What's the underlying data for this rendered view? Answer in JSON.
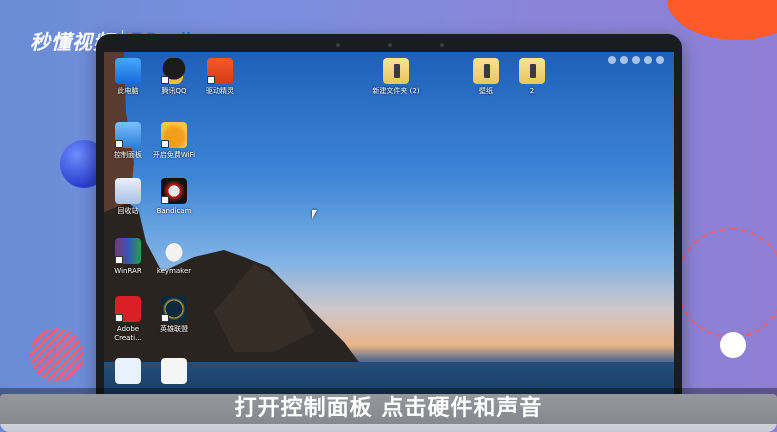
{
  "logo": {
    "main": "秒懂视频",
    "brand": "PConline"
  },
  "desktop": {
    "icons": [
      {
        "id": "this-pc",
        "label": "此电脑"
      },
      {
        "id": "tencent-qq",
        "label": "腾讯QQ"
      },
      {
        "id": "zhuyinjingling",
        "label": "驱动精灵"
      },
      {
        "id": "new-folder",
        "label": "新建文件夹 (2)"
      },
      {
        "id": "folder-1",
        "label": "壁纸"
      },
      {
        "id": "folder-2",
        "label": "2"
      },
      {
        "id": "control-panel",
        "label": "控制面板"
      },
      {
        "id": "wifi",
        "label": "开启免费WiFi"
      },
      {
        "id": "recycle-bin",
        "label": "回收站"
      },
      {
        "id": "bandicam",
        "label": "Bandicam"
      },
      {
        "id": "winrar",
        "label": "WinRAR"
      },
      {
        "id": "keymaker",
        "label": "keymaker"
      },
      {
        "id": "adobe",
        "label": "Adobe Creati..."
      },
      {
        "id": "lol",
        "label": "英雄联盟"
      }
    ]
  },
  "subtitle": "打开控制面板 点击硬件和声音",
  "colors": {
    "accent": "#2d6ff0",
    "deco_orange": "#ff5a2a"
  }
}
